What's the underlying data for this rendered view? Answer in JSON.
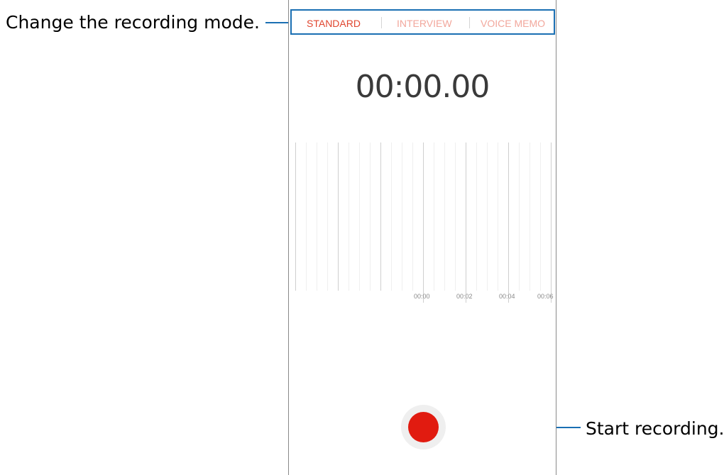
{
  "callouts": {
    "mode": "Change the recording mode.",
    "record": "Start recording."
  },
  "tabs": [
    {
      "label": "STANDARD",
      "active": true
    },
    {
      "label": "INTERVIEW",
      "active": false
    },
    {
      "label": "VOICE MEMO",
      "active": false
    }
  ],
  "timer": "00:00.00",
  "timeline": {
    "ticks": [
      "00:00",
      "00:02",
      "00:04",
      "00:06"
    ]
  },
  "icons": {
    "record": "record-button-icon"
  },
  "colors": {
    "callout_line": "#1a6fb3",
    "active_tab": "#e0452e",
    "inactive_tab": "#f2a79c",
    "record": "#e11b10"
  }
}
